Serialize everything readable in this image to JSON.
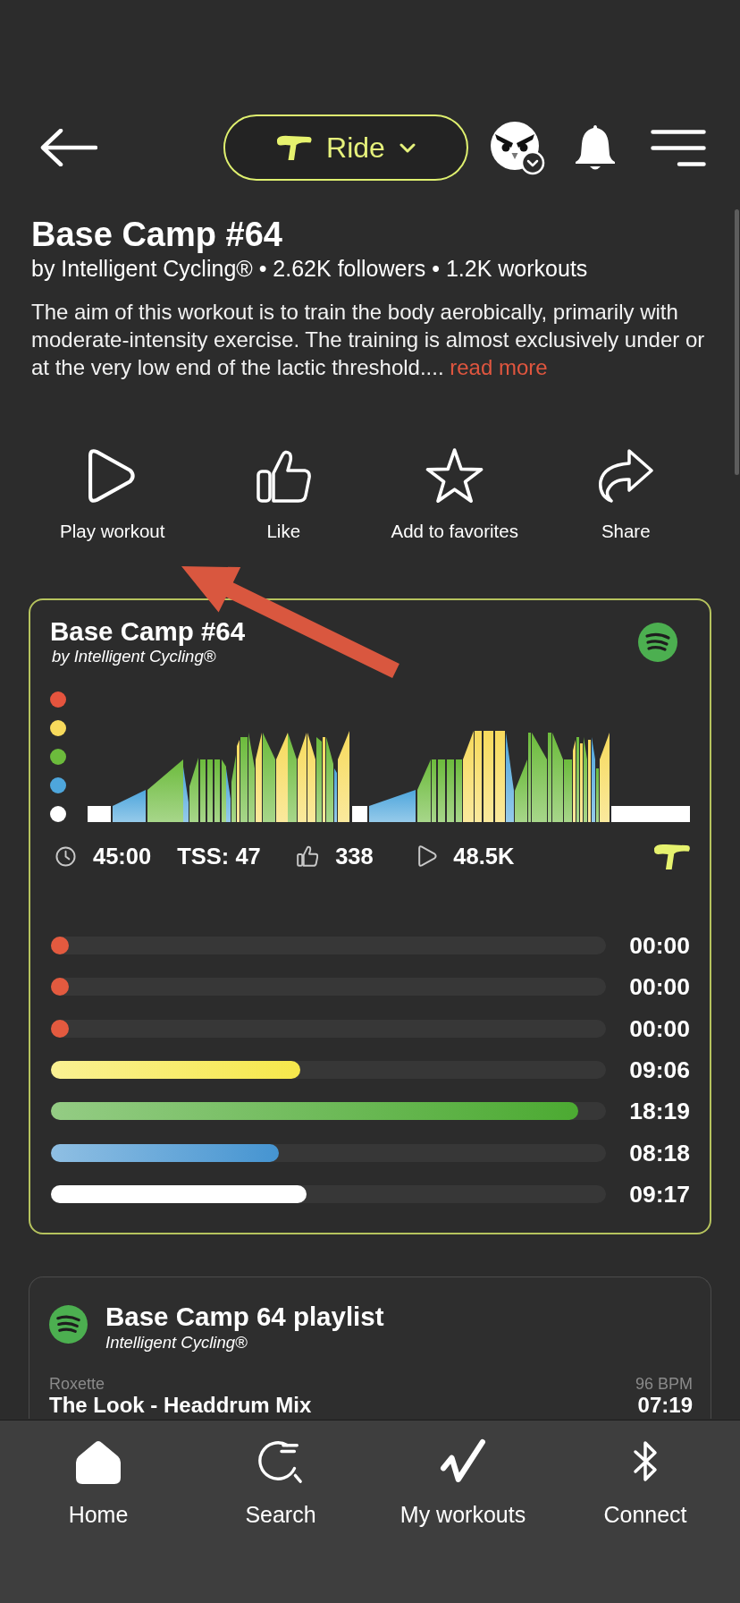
{
  "header": {
    "sport": "Ride"
  },
  "workout": {
    "title": "Base Camp #64",
    "byline": "by Intelligent Cycling® • 2.62K followers • 1.2K workouts",
    "description": "The aim of this workout is to train the body aerobically, primarily with moderate-intensity exercise. The training is almost exclusively under or at the very low end of the lactic threshold....",
    "read_more": "read more"
  },
  "actions": [
    {
      "kind": "play",
      "label": "Play workout"
    },
    {
      "kind": "like",
      "label": "Like"
    },
    {
      "kind": "favorite",
      "label": "Add to favorites"
    },
    {
      "kind": "share",
      "label": "Share"
    }
  ],
  "card": {
    "title": "Base Camp #64",
    "author": "by Intelligent Cycling®",
    "legend": [
      {
        "color": "#e5543e"
      },
      {
        "color": "#f7da5c"
      },
      {
        "color": "#6cbb3c"
      },
      {
        "color": "#4ea6dc"
      },
      {
        "color": "#ffffff"
      }
    ],
    "stats": [
      {
        "kind": "duration",
        "value": "45:00"
      },
      {
        "kind": "tss",
        "value": "TSS: 47"
      },
      {
        "kind": "likes",
        "value": "338"
      },
      {
        "kind": "plays",
        "value": "48.5K"
      }
    ],
    "zones": [
      {
        "color": "#e35a3f",
        "level": 0,
        "time": "00:00"
      },
      {
        "color": "#e35a3f",
        "level": 0,
        "time": "00:00"
      },
      {
        "color": "#e35a3f",
        "level": 0,
        "time": "00:00"
      },
      {
        "color": "#f6e84b",
        "level": 0.45,
        "time": "09:06"
      },
      {
        "color": "#4caa32",
        "level": 0.95,
        "time": "18:19"
      },
      {
        "color": "#4594d1",
        "level": 0.41,
        "time": "08:18"
      },
      {
        "color": "#ffffff",
        "level": 0.46,
        "time": "09:17"
      }
    ]
  },
  "playlist": {
    "title": "Base Camp 64 playlist",
    "author": "Intelligent Cycling®",
    "tracks": [
      {
        "artist": "Roxette",
        "bpm": "96 BPM",
        "title": "The Look - Headdrum Mix",
        "duration": "07:19"
      }
    ]
  },
  "nav": [
    {
      "kind": "home",
      "label": "Home"
    },
    {
      "kind": "search",
      "label": "Search"
    },
    {
      "kind": "workouts",
      "label": "My workouts"
    },
    {
      "kind": "connect",
      "label": "Connect"
    }
  ]
}
